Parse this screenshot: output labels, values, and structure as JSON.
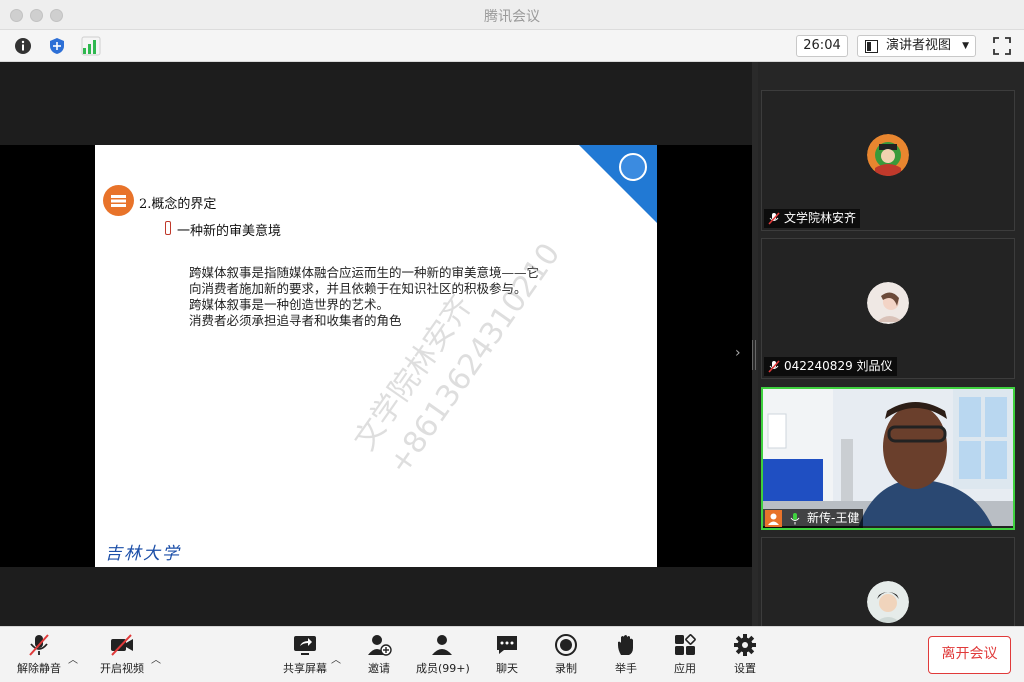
{
  "window": {
    "title": "腾讯会议"
  },
  "toolbar": {
    "timer": "26:04",
    "view_label": "演讲者视图"
  },
  "slide": {
    "section_title": "2.概念的界定",
    "subtitle": "一种新的审美意境",
    "body_lines": [
      "跨媒体叙事是指随媒体融合应运而生的一种新的审美意境——它",
      "向消费者施加新的要求，并且依赖于在知识社区的积极参与。",
      "跨媒体叙事是一种创造世界的艺术。",
      "消费者必须承担追寻者和收集者的角色"
    ],
    "watermark_lines": [
      "文学院林安齐",
      "+8613624310210"
    ],
    "logo_text": "吉林大学"
  },
  "participants": [
    {
      "name": "文学院林安齐",
      "muted": true
    },
    {
      "name": "042240829 刘品仪",
      "muted": true
    },
    {
      "name": "新传-王健",
      "muted": false,
      "speaking": true
    },
    {
      "name": "",
      "muted": false
    }
  ],
  "bottombar": {
    "unmute": "解除静音",
    "start_video": "开启视频",
    "share_screen": "共享屏幕",
    "invite": "邀请",
    "members": "成员(99+)",
    "chat": "聊天",
    "record": "录制",
    "raise_hand": "举手",
    "apps": "应用",
    "settings": "设置",
    "leave": "离开会议"
  },
  "colors": {
    "accent_blue": "#2179d4",
    "leave_red": "#e03a3a",
    "active_green": "#3fd13f",
    "signal_green": "#2fb84f"
  }
}
